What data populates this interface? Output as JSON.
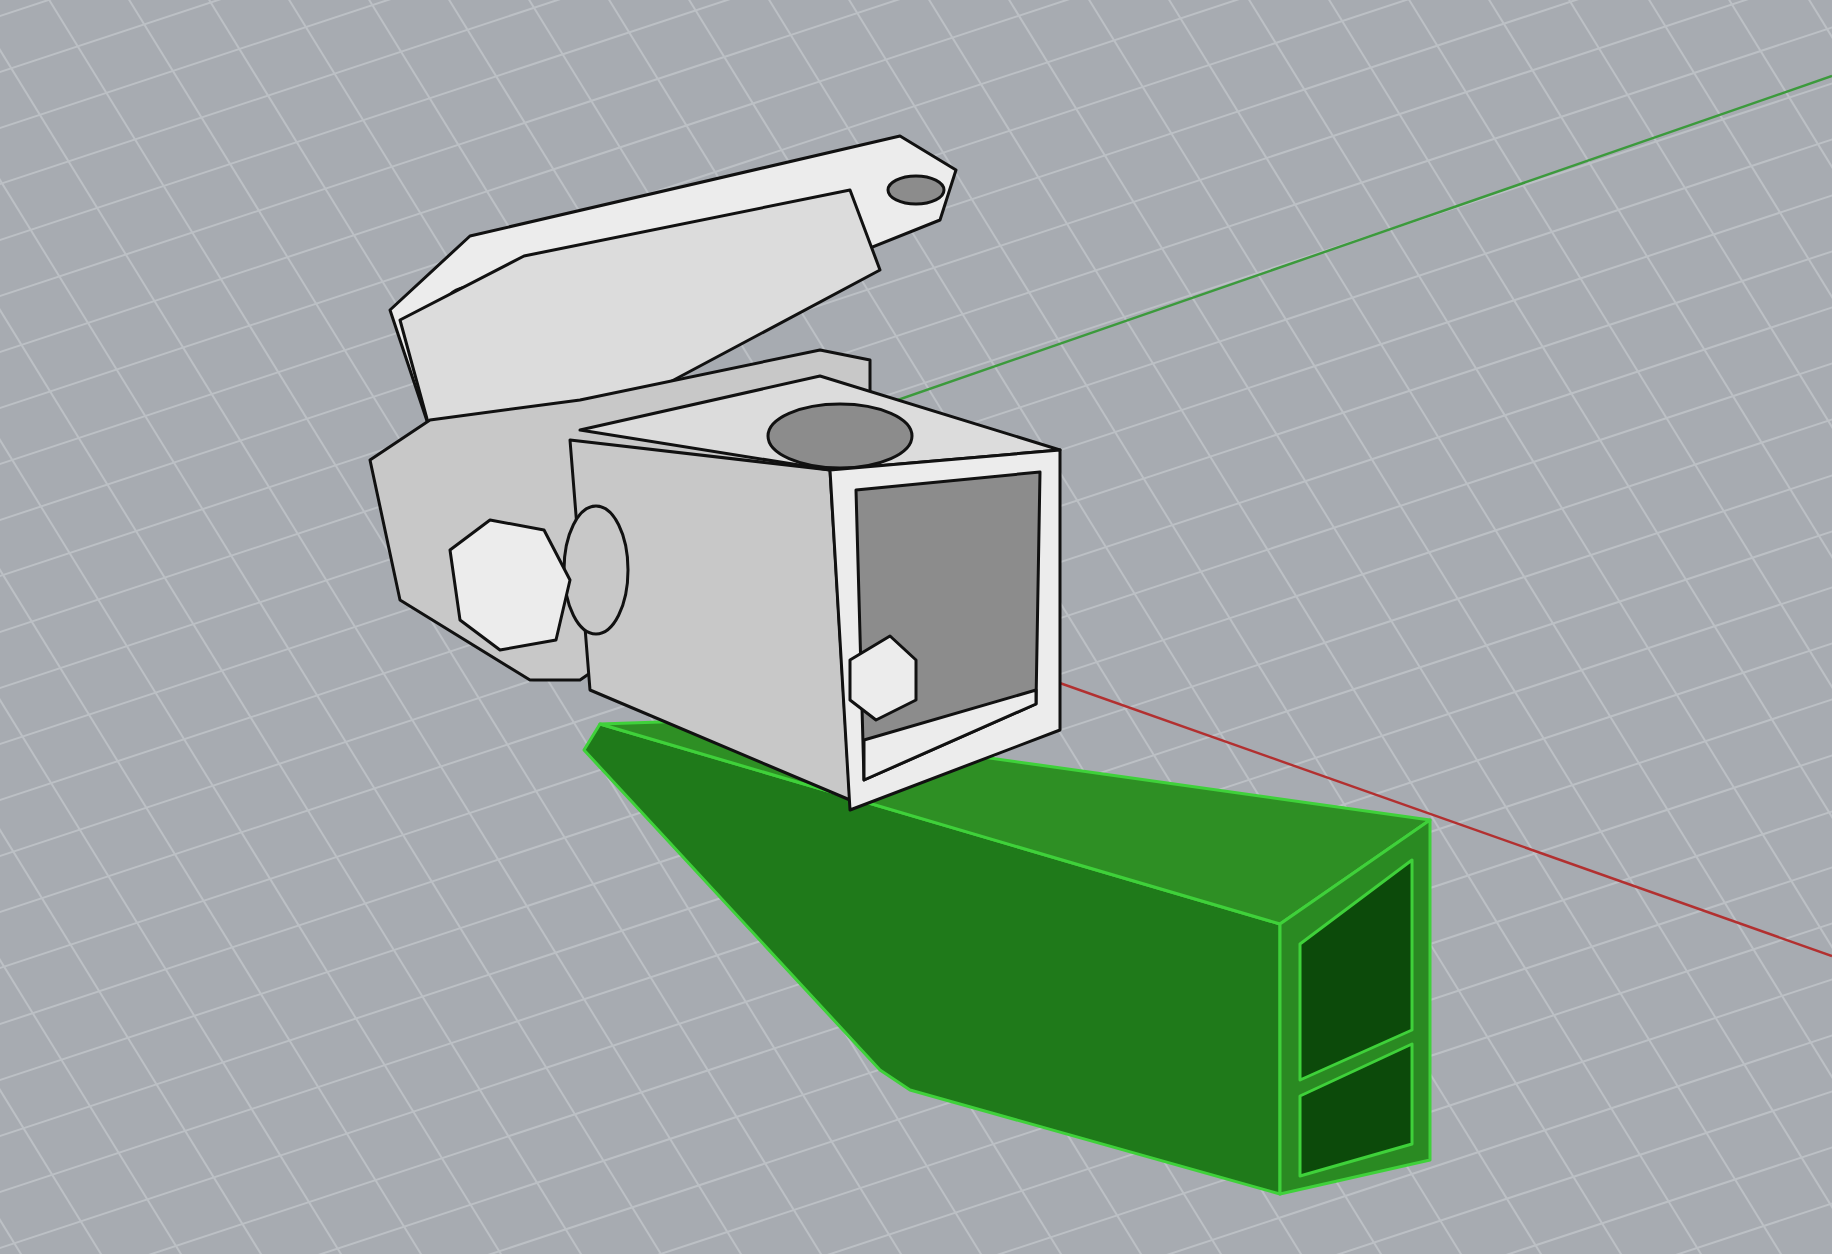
{
  "viewport": {
    "parts": [
      {
        "kind": "bracket",
        "selected": false
      },
      {
        "kind": "tube",
        "selected": true
      }
    ]
  }
}
